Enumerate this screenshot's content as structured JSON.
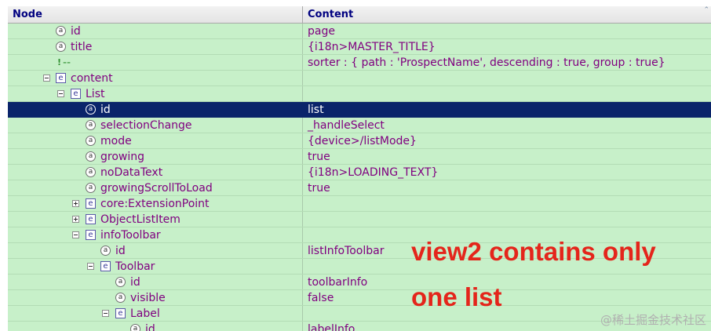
{
  "header": {
    "node": "Node",
    "content": "Content"
  },
  "rows": [
    {
      "type": "attr",
      "label": "id",
      "content": "page"
    },
    {
      "type": "attr",
      "label": "title",
      "content": "{i18n>MASTER_TITLE}"
    },
    {
      "type": "comment",
      "label": "--",
      "content": " sorter : { path : 'ProspectName', descending : true, group : true}"
    },
    {
      "type": "element",
      "label": "content",
      "content": ""
    },
    {
      "type": "element",
      "label": "List",
      "content": ""
    },
    {
      "type": "attr",
      "label": "id",
      "content": "list"
    },
    {
      "type": "attr",
      "label": "selectionChange",
      "content": "_handleSelect"
    },
    {
      "type": "attr",
      "label": "mode",
      "content": "{device>/listMode}"
    },
    {
      "type": "attr",
      "label": "growing",
      "content": "true"
    },
    {
      "type": "attr",
      "label": "noDataText",
      "content": "{i18n>LOADING_TEXT}"
    },
    {
      "type": "attr",
      "label": "growingScrollToLoad",
      "content": "true"
    },
    {
      "type": "element",
      "label": "core:ExtensionPoint",
      "content": ""
    },
    {
      "type": "element",
      "label": "ObjectListItem",
      "content": ""
    },
    {
      "type": "element",
      "label": "infoToolbar",
      "content": ""
    },
    {
      "type": "attr",
      "label": "id",
      "content": "listInfoToolbar"
    },
    {
      "type": "element",
      "label": "Toolbar",
      "content": ""
    },
    {
      "type": "attr",
      "label": "id",
      "content": "toolbarInfo"
    },
    {
      "type": "attr",
      "label": "visible",
      "content": "false"
    },
    {
      "type": "element",
      "label": "Label",
      "content": ""
    },
    {
      "type": "attr",
      "label": "id",
      "content": "labelInfo"
    }
  ],
  "annotation": {
    "line1": "view2 contains only",
    "line2": "one list"
  },
  "watermark": "@稀土掘金技术社区",
  "selected_row_index": 5
}
